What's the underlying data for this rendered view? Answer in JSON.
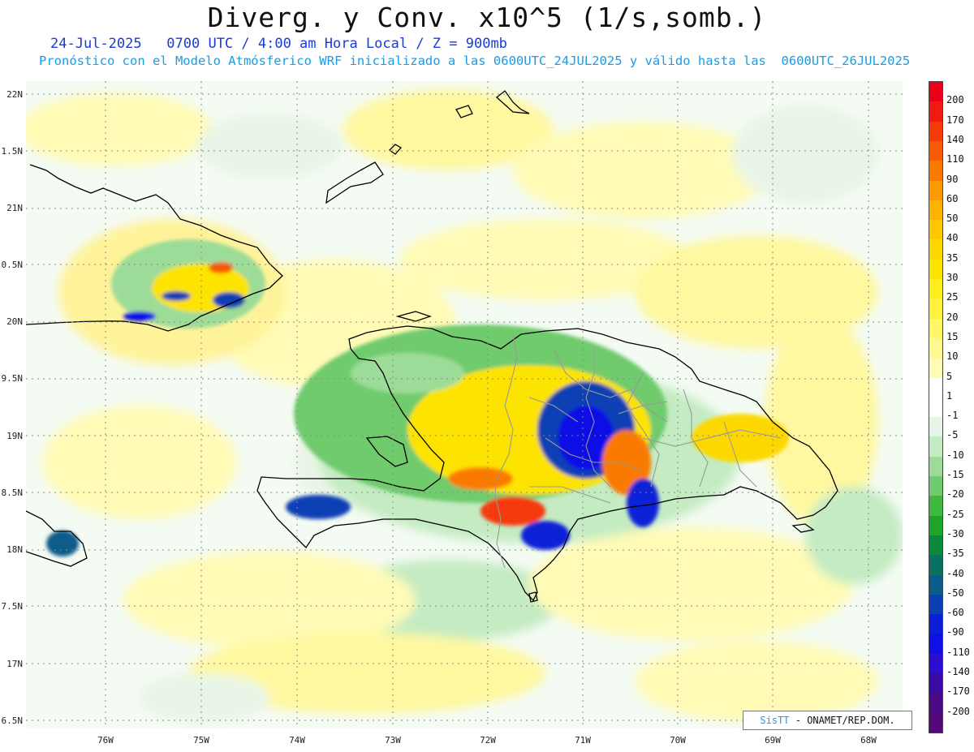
{
  "title": "Diverg. y Conv. x10^5 (1/s,somb.)",
  "subtitle_date": "24-Jul-2025   0700 UTC / 4:00 am Hora Local / Z = 900mb",
  "subtitle_model": "Pronóstico con el Modelo Atmósferico WRF inicializado a las 0600UTC_24JUL2025 y válido hasta las  0600UTC_26JUL2025",
  "credit": {
    "brand": "SisTT",
    "org": " - ONAMET/REP.DOM."
  },
  "lat_labels": [
    "22N",
    "1.5N",
    "21N",
    "0.5N",
    "20N",
    "9.5N",
    "19N",
    "8.5N",
    "18N",
    "7.5N",
    "17N",
    "6.5N"
  ],
  "lon_labels": [
    "76W",
    "75W",
    "74W",
    "73W",
    "72W",
    "71W",
    "70W",
    "69W",
    "68W"
  ],
  "colorbar": {
    "labels": [
      "200",
      "170",
      "140",
      "110",
      "90",
      "60",
      "50",
      "40",
      "35",
      "30",
      "25",
      "20",
      "15",
      "10",
      "5",
      "1",
      "-1",
      "-5",
      "-10",
      "-15",
      "-20",
      "-25",
      "-30",
      "-35",
      "-40",
      "-50",
      "-60",
      "-90",
      "-110",
      "-140",
      "-170",
      "-200"
    ],
    "colors": [
      "#e8001c",
      "#f21a10",
      "#f53a0a",
      "#f75a05",
      "#fa7a00",
      "#fc9a00",
      "#fdb400",
      "#fdc800",
      "#fdd800",
      "#fde300",
      "#feee20",
      "#fff23c",
      "#fff66a",
      "#fff890",
      "#fffbb6",
      "#ffffff",
      "#ffffff",
      "#e8f5e6",
      "#c4ebc2",
      "#9ddc98",
      "#6fcb6d",
      "#3eb93e",
      "#1fa32a",
      "#0a8a38",
      "#0a7060",
      "#0a5c8a",
      "#0a3fb5",
      "#0a20d6",
      "#1010e6",
      "#2a0fd0",
      "#3a0aa6",
      "#4c0a85",
      "#55087a"
    ]
  },
  "colors": {
    "title": "#111111",
    "subtitle_date": "#1a3bd6",
    "subtitle_model": "#1a9be6",
    "coast": "#000000",
    "border_provinces": "#999999"
  }
}
